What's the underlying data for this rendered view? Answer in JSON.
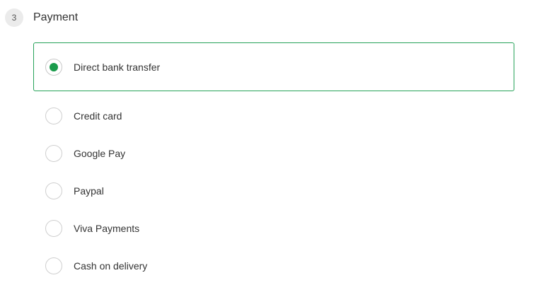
{
  "step": {
    "number": "3",
    "title": "Payment"
  },
  "payment_options": [
    {
      "label": "Direct bank transfer",
      "selected": true
    },
    {
      "label": "Credit card",
      "selected": false
    },
    {
      "label": "Google Pay",
      "selected": false
    },
    {
      "label": "Paypal",
      "selected": false
    },
    {
      "label": "Viva Payments",
      "selected": false
    },
    {
      "label": "Cash on delivery",
      "selected": false
    }
  ],
  "colors": {
    "accent": "#1a9b4b",
    "selected_border": "#27a35a",
    "step_badge_bg": "#ebebeb"
  }
}
